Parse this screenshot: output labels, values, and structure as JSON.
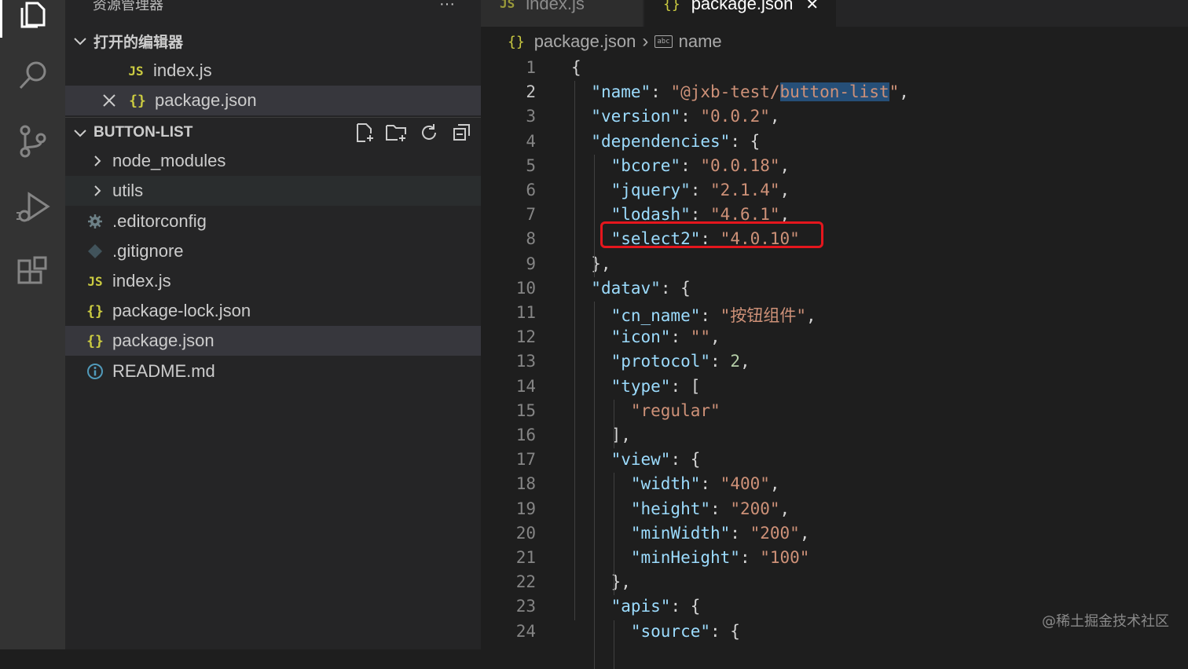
{
  "sidebar": {
    "explorer_title": "资源管理器",
    "more_label": "···",
    "open_editors_title": "打开的编辑器",
    "open_editors": [
      {
        "name": "index.js",
        "icon": "JS"
      },
      {
        "name": "package.json",
        "icon": "{}"
      }
    ],
    "project_title": "BUTTON-LIST",
    "tree": [
      {
        "name": "node_modules",
        "kind": "folder"
      },
      {
        "name": "utils",
        "kind": "folder"
      },
      {
        "name": ".editorconfig",
        "kind": "gear-file"
      },
      {
        "name": ".gitignore",
        "kind": "git-file"
      },
      {
        "name": "index.js",
        "kind": "js-file",
        "icon": "JS"
      },
      {
        "name": "package-lock.json",
        "kind": "json-file",
        "icon": "{}"
      },
      {
        "name": "package.json",
        "kind": "json-file",
        "icon": "{}"
      },
      {
        "name": "README.md",
        "kind": "info-file"
      }
    ]
  },
  "tabs": [
    {
      "label": "index.js",
      "icon": "JS",
      "active": false
    },
    {
      "label": "package.json",
      "icon": "{}",
      "active": true,
      "close": "✕"
    }
  ],
  "breadcrumb": {
    "icon": "{}",
    "file": "package.json",
    "separator": "›",
    "symbol_icon": "abc",
    "symbol": "name"
  },
  "editor": {
    "lines": [
      {
        "n": "1",
        "text": "{"
      },
      {
        "n": "2",
        "text": "  \"name\": \"@jxb-test/button-list\","
      },
      {
        "n": "3",
        "text": "  \"version\": \"0.0.2\","
      },
      {
        "n": "4",
        "text": "  \"dependencies\": {"
      },
      {
        "n": "5",
        "text": "    \"bcore\": \"0.0.18\","
      },
      {
        "n": "6",
        "text": "    \"jquery\": \"2.1.4\","
      },
      {
        "n": "7",
        "text": "    \"lodash\": \"4.6.1\","
      },
      {
        "n": "8",
        "text": "    \"select2\": \"4.0.10\""
      },
      {
        "n": "9",
        "text": "  },"
      },
      {
        "n": "10",
        "text": "  \"datav\": {"
      },
      {
        "n": "11",
        "text": "    \"cn_name\": \"按钮组件\","
      },
      {
        "n": "12",
        "text": "    \"icon\": \"\","
      },
      {
        "n": "13",
        "text": "    \"protocol\": 2,"
      },
      {
        "n": "14",
        "text": "    \"type\": ["
      },
      {
        "n": "15",
        "text": "      \"regular\""
      },
      {
        "n": "16",
        "text": "    ],"
      },
      {
        "n": "17",
        "text": "    \"view\": {"
      },
      {
        "n": "18",
        "text": "      \"width\": \"400\","
      },
      {
        "n": "19",
        "text": "      \"height\": \"200\","
      },
      {
        "n": "20",
        "text": "      \"minWidth\": \"200\","
      },
      {
        "n": "21",
        "text": "      \"minHeight\": \"100\""
      },
      {
        "n": "22",
        "text": "    },"
      },
      {
        "n": "23",
        "text": "    \"apis\": {"
      },
      {
        "n": "24",
        "text": "      \"source\": {"
      }
    ]
  },
  "watermark": "@稀土掘金技术社区",
  "colors": {
    "highlight_box": "#e5161d",
    "selection": "#264f78",
    "key": "#9cdcfe",
    "string": "#ce9178",
    "number": "#b5cea8"
  }
}
